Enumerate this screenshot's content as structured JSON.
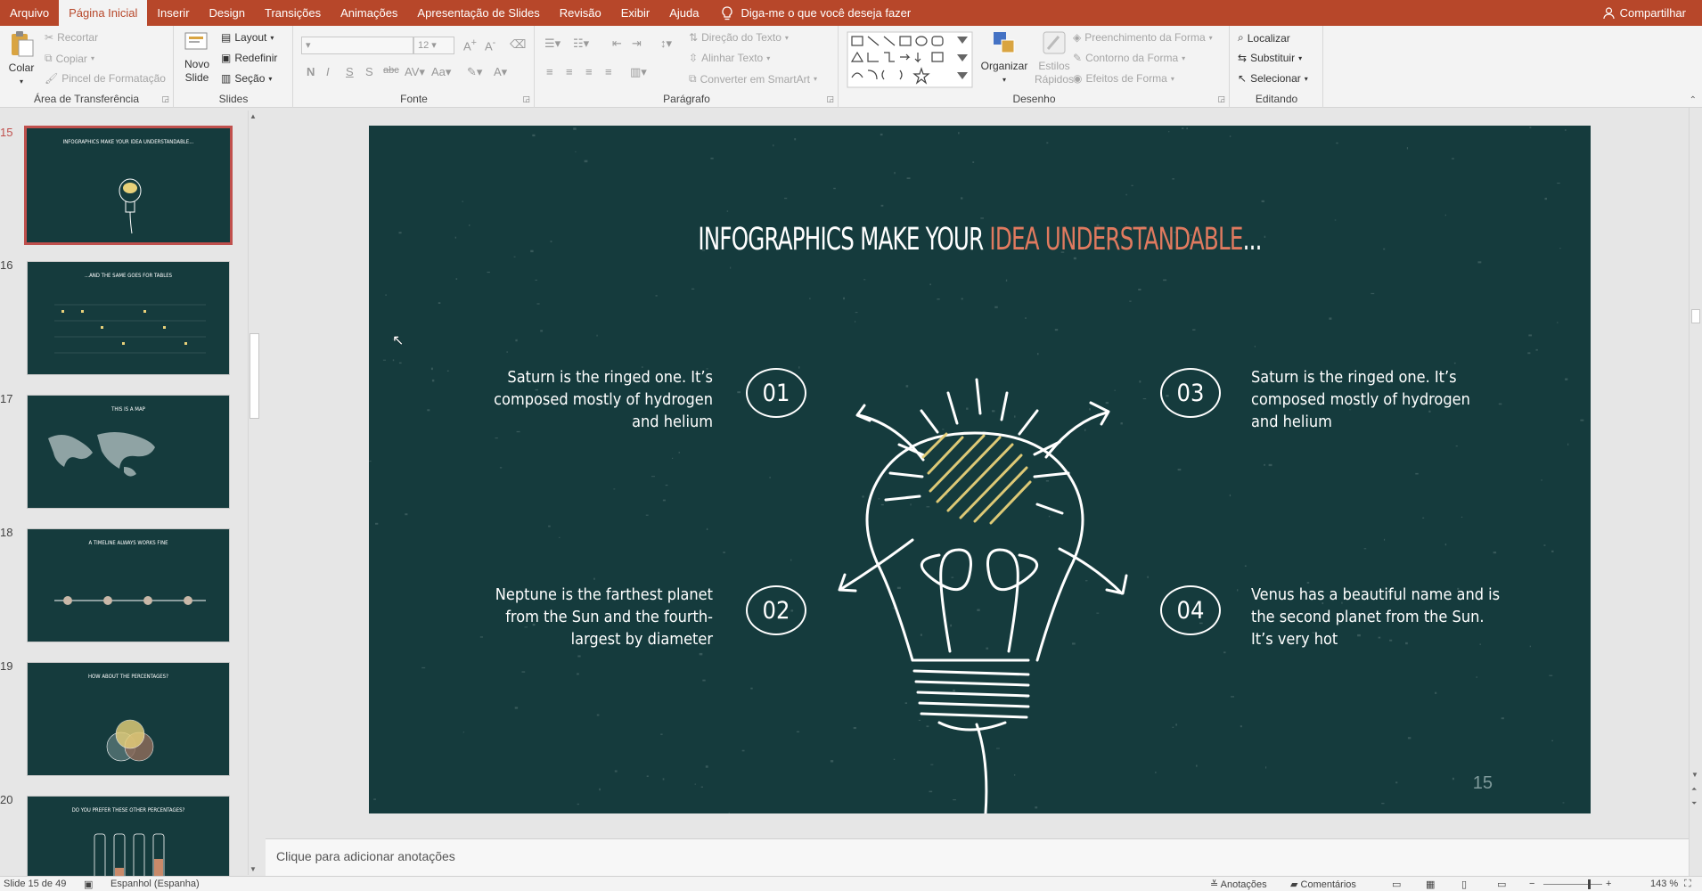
{
  "tabs": [
    "Arquivo",
    "Página Inicial",
    "Inserir",
    "Design",
    "Transições",
    "Animações",
    "Apresentação de Slides",
    "Revisão",
    "Exibir",
    "Ajuda"
  ],
  "tell_me": "Diga-me o que você deseja fazer",
  "share": "Compartilhar",
  "ribbon": {
    "clipboard": {
      "label": "Área de Transferência",
      "paste": "Colar",
      "cut": "Recortar",
      "copy": "Copiar",
      "format_painter": "Pincel de Formatação"
    },
    "slides": {
      "label": "Slides",
      "new_slide": "Novo Slide",
      "layout": "Layout",
      "reset": "Redefinir",
      "section": "Seção"
    },
    "font": {
      "label": "Fonte",
      "size": "12"
    },
    "paragraph": {
      "label": "Parágrafo",
      "text_direction": "Direção do Texto",
      "align_text": "Alinhar Texto",
      "smartart": "Converter em SmartArt"
    },
    "drawing": {
      "label": "Desenho",
      "arrange": "Organizar",
      "quick_styles": "Estilos Rápidos",
      "fill": "Preenchimento da Forma",
      "outline": "Contorno da Forma",
      "effects": "Efeitos de Forma"
    },
    "editing": {
      "label": "Editando",
      "find": "Localizar",
      "replace": "Substituir",
      "select": "Selecionar"
    }
  },
  "thumbnails": [
    {
      "num": "15",
      "title": "INFOGRAPHICS MAKE YOUR IDEA UNDERSTANDABLE..."
    },
    {
      "num": "16",
      "title": "...AND THE SAME GOES FOR TABLES"
    },
    {
      "num": "17",
      "title": "THIS IS A MAP"
    },
    {
      "num": "18",
      "title": "A TIMELINE ALWAYS WORKS FINE"
    },
    {
      "num": "19",
      "title": "HOW ABOUT THE PERCENTAGES?"
    },
    {
      "num": "20",
      "title": "DO YOU PREFER THESE OTHER PERCENTAGES?"
    }
  ],
  "slide": {
    "title_white": "INFOGRAPHICS MAKE YOUR ",
    "title_accent": "IDEA UNDERSTANDABLE",
    "title_end": "...",
    "items": [
      {
        "num": "01",
        "text": "Saturn is the ringed one. It’s composed mostly of hydrogen and helium"
      },
      {
        "num": "02",
        "text": "Neptune is the farthest planet from the Sun and the fourth-largest by diameter"
      },
      {
        "num": "03",
        "text": "Saturn is the ringed one. It’s composed mostly of hydrogen and helium"
      },
      {
        "num": "04",
        "text": "Venus has a beautiful name and is the second planet from the Sun. It’s very hot"
      }
    ],
    "page_number": "15"
  },
  "notes_placeholder": "Clique para adicionar anotações",
  "status": {
    "slide_info": "Slide 15 de 49",
    "language": "Espanhol (Espanha)",
    "notes": "Anotações",
    "comments": "Comentários",
    "zoom": "143 %"
  },
  "colors": {
    "accent": "#b7472a",
    "slide_bg": "#153b3d",
    "title_accent": "#e07a5f",
    "bulb_fill": "#e8d17a"
  }
}
